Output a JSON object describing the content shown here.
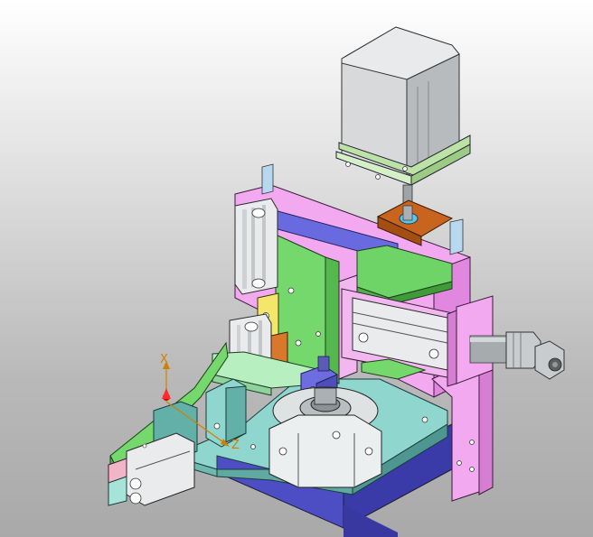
{
  "viewport": {
    "background_top": "#ffffff",
    "background_bottom": "#a9a9a9"
  },
  "triad": {
    "x_label": "X",
    "z_label": "Z",
    "x_color": "#d08000",
    "z_color": "#d08000",
    "origin_color": "#e00000"
  },
  "colors": {
    "motor_body": "#cfd1d2",
    "motor_flange": "#bde2a6",
    "coupling_block": "#c8641e",
    "back_plate": "#f2a9f0",
    "blue_bar": "#6a6ae0",
    "green_slider": "#74d86c",
    "yellow_part": "#f4e66a",
    "orange_part": "#d9782a",
    "base_plate": "#8fd6cf",
    "base_lower": "#5a5ad0",
    "cylinder_silver": "#e9ebec",
    "rod_gray": "#9ea3a6"
  }
}
